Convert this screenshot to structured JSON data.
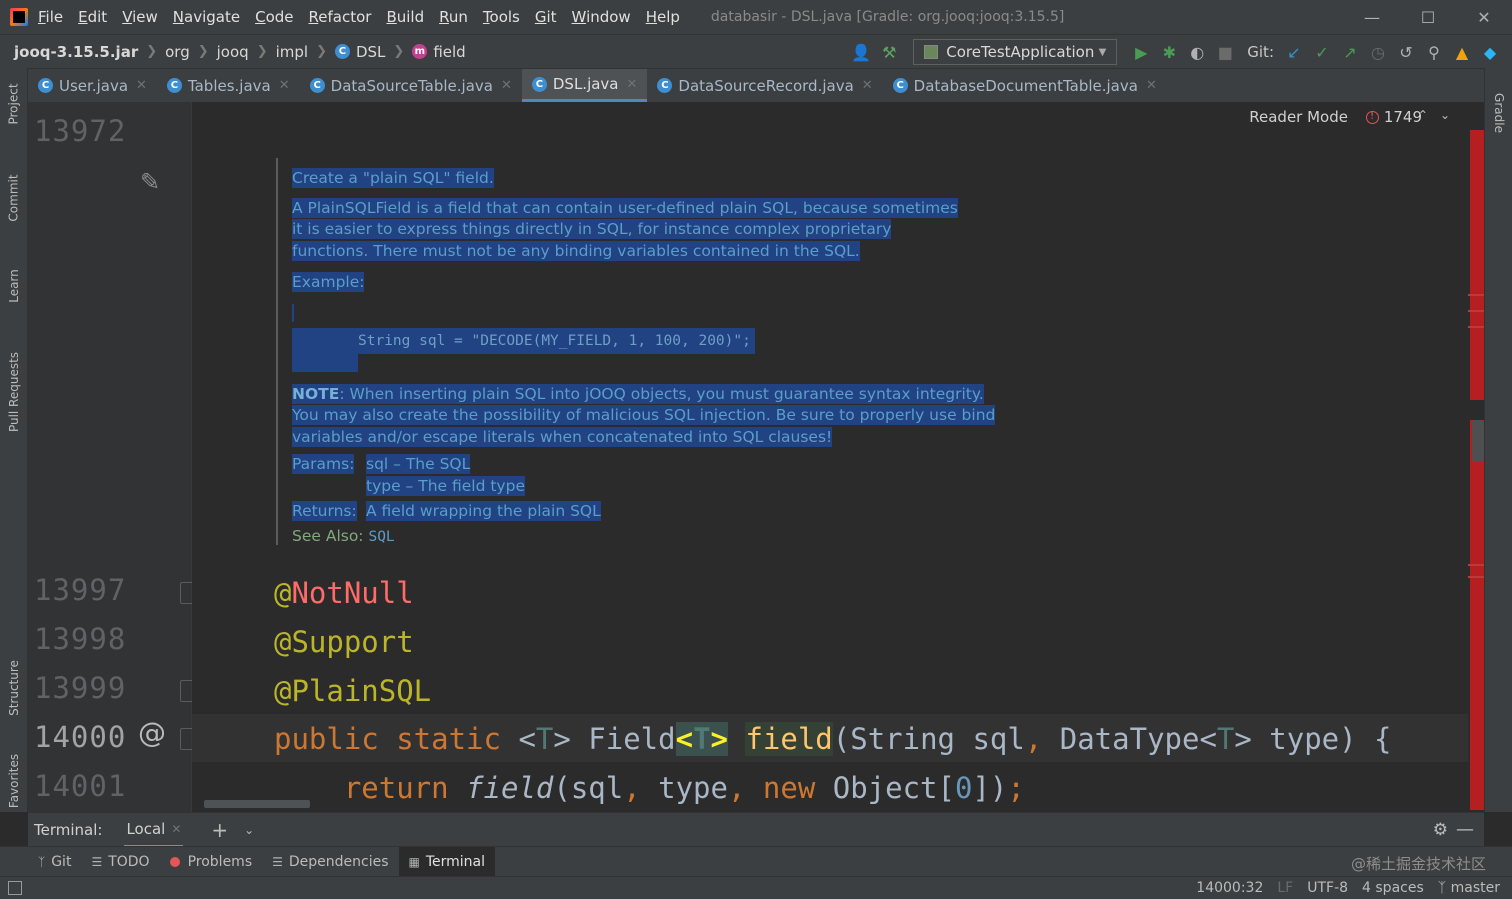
{
  "menubar": {
    "items": [
      "File",
      "Edit",
      "View",
      "Navigate",
      "Code",
      "Refactor",
      "Build",
      "Run",
      "Tools",
      "Git",
      "Window",
      "Help"
    ],
    "title": "databasir - DSL.java [Gradle: org.jooq:jooq:3.15.5]"
  },
  "breadcrumbs": [
    "jooq-3.15.5.jar",
    "org",
    "jooq",
    "impl",
    "DSL",
    "field"
  ],
  "toolbar": {
    "run_config": "CoreTestApplication",
    "git_label": "Git:"
  },
  "tabs": [
    "User.java",
    "Tables.java",
    "DataSourceTable.java",
    "DSL.java",
    "DataSourceRecord.java",
    "DatabaseDocumentTable.java"
  ],
  "active_tab": "DSL.java",
  "left_tools": [
    "Project",
    "Commit",
    "Learn",
    "Pull Requests",
    "Structure",
    "Favorites"
  ],
  "right_tools": [
    "Gradle"
  ],
  "editor": {
    "reader_mode": "Reader Mode",
    "error_count": "1749",
    "line_numbers": [
      "13972",
      "13997",
      "13998",
      "13999",
      "14000",
      "14001"
    ]
  },
  "doc": {
    "summary": "Create a \"plain SQL\" field.",
    "description": "A PlainSQLField is a field that can contain user-defined plain SQL, because sometimes it is easier to express things directly in SQL, for instance complex proprietary functions. There must not be any binding variables contained in the SQL.",
    "example_label": "Example:",
    "example_code": "String sql = \"DECODE(MY_FIELD, 1, 100, 200)\";",
    "note_label": "NOTE",
    "note_text": ": When inserting plain SQL into jOOQ objects, you must guarantee syntax integrity. You may also create the possibility of malicious SQL injection. Be sure to properly use bind variables and/or escape literals when concatenated into SQL clauses!",
    "params_label": "Params:",
    "params": [
      "sql – The SQL",
      "type – The field type"
    ],
    "returns_label": "Returns:",
    "returns": "A field wrapping the plain SQL",
    "see_also_label": "See Also:",
    "see_also": "SQL"
  },
  "code": {
    "l13997": "NotNull",
    "l13998": "@Support",
    "l13999": "@PlainSQL"
  },
  "terminal": {
    "title": "Terminal:",
    "tab": "Local"
  },
  "bottom_tools": [
    "Git",
    "TODO",
    "Problems",
    "Dependencies",
    "Terminal"
  ],
  "watermark": "@稀土掘金技术社区",
  "status": {
    "position": "14000:32",
    "line_sep": "LF",
    "encoding": "UTF-8",
    "indent": "4 spaces",
    "branch": "master"
  },
  "colors": {
    "selection": "#214283",
    "doc_text": "#5d9cc8",
    "keyword": "#cc7832",
    "annotation": "#bbb529",
    "error_annotation": "#ff6b68",
    "method": "#ffc66d",
    "error_stripe": "#b51f1f"
  }
}
